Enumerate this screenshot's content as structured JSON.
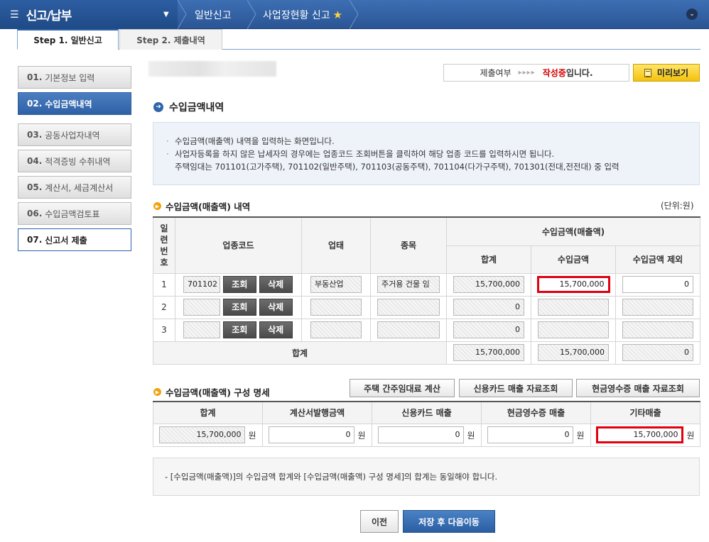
{
  "topbar": {
    "menu_title": "신고/납부",
    "crumb1": "일반신고",
    "crumb2": "사업장현황 신고"
  },
  "tabs": [
    {
      "label": "Step 1. 일반신고",
      "active": true
    },
    {
      "label": "Step 2. 제출내역",
      "active": false
    }
  ],
  "sidebar": {
    "items": [
      {
        "num": "01.",
        "label": "기본정보 입력"
      },
      {
        "num": "02.",
        "label": "수입금액내역"
      },
      {
        "num": "03.",
        "label": "공동사업자내역"
      },
      {
        "num": "04.",
        "label": "적격증빙 수취내역"
      },
      {
        "num": "05.",
        "label": "계산서, 세금계산서"
      },
      {
        "num": "06.",
        "label": "수입금액검토표"
      },
      {
        "num": "07.",
        "label": "신고서 제출"
      }
    ]
  },
  "status": {
    "prefix": "제출여부",
    "arrows": "▸▸▸▸",
    "state": "작성중",
    "suffix": "입니다."
  },
  "preview_label": "미리보기",
  "section_title": "수입금액내역",
  "info": {
    "line1": "수입금액(매출액) 내역을 입력하는 화면입니다.",
    "line2": "사업자등록을 하지 않은 납세자의 경우에는 업종코드 조회버튼을 클릭하여 해당 업종 코드를 입력하시면 됩니다.",
    "line3": "주택임대는 701101(고가주택), 701102(일반주택), 701103(공동주택), 701104(다가구주택), 701301(전대,전전대) 중 입력"
  },
  "income_table": {
    "title": "수입금액(매출액) 내역",
    "unit": "(단위:원)",
    "headers": {
      "serial": "일련번호",
      "code": "업종코드",
      "business_type": "업태",
      "item": "종목",
      "income_group": "수입금액(매출액)",
      "total": "합계",
      "income": "수입금액",
      "excluded": "수입금액 제외"
    },
    "lookup_label": "조회",
    "delete_label": "삭제",
    "rows": [
      {
        "no": "1",
        "code": "701102",
        "business_type": "부동산업",
        "item": "주거용 건물 임",
        "total": "15,700,000",
        "income": "15,700,000",
        "excluded": "0"
      },
      {
        "no": "2",
        "code": "",
        "business_type": "",
        "item": "",
        "total": "0",
        "income": "",
        "excluded": ""
      },
      {
        "no": "3",
        "code": "",
        "business_type": "",
        "item": "",
        "total": "0",
        "income": "",
        "excluded": ""
      }
    ],
    "sum": {
      "label": "합계",
      "total": "15,700,000",
      "income": "15,700,000",
      "excluded": "0"
    }
  },
  "composition": {
    "title": "수입금액(매출액) 구성 명세",
    "buttons": {
      "housing": "주택 간주임대료 계산",
      "card": "신용카드 매출 자료조회",
      "cash": "현금영수증 매출 자료조회"
    },
    "headers": [
      "합계",
      "계산서발행금액",
      "신용카드 매출",
      "현금영수증 매출",
      "기타매출"
    ],
    "values": [
      "15,700,000",
      "0",
      "0",
      "0",
      "15,700,000"
    ],
    "unit_label": "원"
  },
  "note": "- [수입금액(매출액)]의 수입금액 합계와 [수입금액(매출액) 구성 명세]의 합계는 동일해야 합니다.",
  "buttons": {
    "prev": "이전",
    "next": "저장 후 다음이동"
  }
}
